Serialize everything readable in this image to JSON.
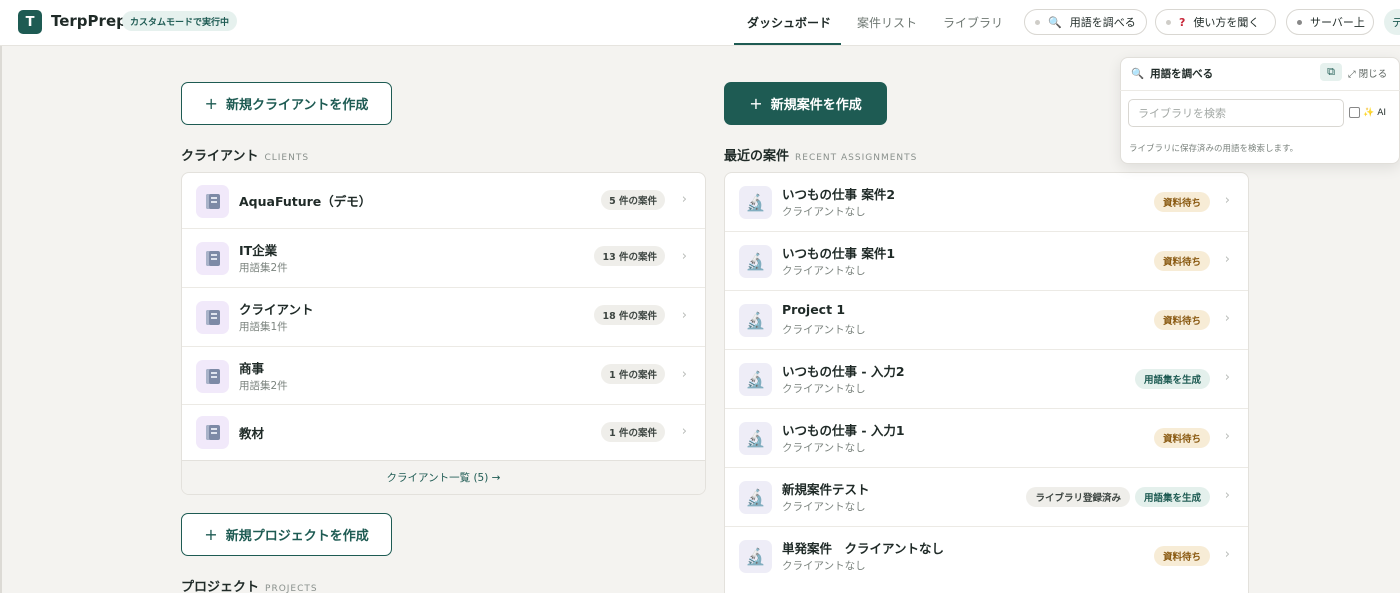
{
  "header": {
    "logo_letter": "T",
    "app_title": "TerpPrep",
    "mode_badge": "カスタムモードで実行中",
    "nav": [
      "ダッシュボード",
      "案件リスト",
      "ライブラリ"
    ],
    "pills": [
      {
        "label": "用語を調べる",
        "icon": "search-icon"
      },
      {
        "label": "使い方を聞く",
        "icon": "question-icon"
      },
      {
        "label": "サーバー上",
        "icon": "status-dot"
      }
    ],
    "edge_pill": "デ"
  },
  "clients_section": {
    "new_button": "新規クライアントを作成",
    "title": "クライアント",
    "subtitle": "CLIENTS",
    "items": [
      {
        "name": "AquaFuture（デモ）",
        "sub": "",
        "count": "5 件の案件"
      },
      {
        "name": "IT企業",
        "sub": "用語集2件",
        "count": "13 件の案件"
      },
      {
        "name": "クライアント",
        "sub": "用語集1件",
        "count": "18 件の案件"
      },
      {
        "name": "商事",
        "sub": "用語集2件",
        "count": "1 件の案件"
      },
      {
        "name": "教材",
        "sub": "",
        "count": "1 件の案件"
      }
    ],
    "footer_link": "クライアント一覧 (5) →"
  },
  "projects_section": {
    "new_button": "新規プロジェクトを作成",
    "title": "プロジェクト",
    "subtitle": "PROJECTS"
  },
  "assignments_section": {
    "new_button": "新規案件を作成",
    "title": "最近の案件",
    "subtitle": "RECENT ASSIGNMENTS",
    "items": [
      {
        "name": "いつもの仕事 案件2",
        "sub": "クライアントなし",
        "statuses": [
          {
            "label": "資料待ち",
            "kind": "wait"
          }
        ]
      },
      {
        "name": "いつもの仕事 案件1",
        "sub": "クライアントなし",
        "statuses": [
          {
            "label": "資料待ち",
            "kind": "wait"
          }
        ]
      },
      {
        "name": "Project 1",
        "sub": "クライアントなし",
        "statuses": [
          {
            "label": "資料待ち",
            "kind": "wait"
          }
        ]
      },
      {
        "name": "いつもの仕事 - 入力2",
        "sub": "クライアントなし",
        "statuses": [
          {
            "label": "用語集を生成",
            "kind": "gen"
          }
        ]
      },
      {
        "name": "いつもの仕事 - 入力1",
        "sub": "クライアントなし",
        "statuses": [
          {
            "label": "資料待ち",
            "kind": "wait"
          }
        ]
      },
      {
        "name": "新規案件テスト",
        "sub": "クライアントなし",
        "statuses": [
          {
            "label": "ライブラリ登録済み",
            "kind": "reg"
          },
          {
            "label": "用語集を生成",
            "kind": "gen"
          }
        ]
      },
      {
        "name": "単発案件　クライアントなし",
        "sub": "クライアントなし",
        "statuses": [
          {
            "label": "資料待ち",
            "kind": "wait"
          }
        ]
      }
    ]
  },
  "lookup_popover": {
    "title": "用語を調べる",
    "close_label": "閉じる",
    "search_placeholder": "ライブラリを検索",
    "ai_label": "AI",
    "help_text": "ライブラリに保存済みの用語を検索します。"
  },
  "colors": {
    "accent": "#1e5b53",
    "wait_badge": "#f7ecd6",
    "generate_badge": "#e4f0ec"
  }
}
